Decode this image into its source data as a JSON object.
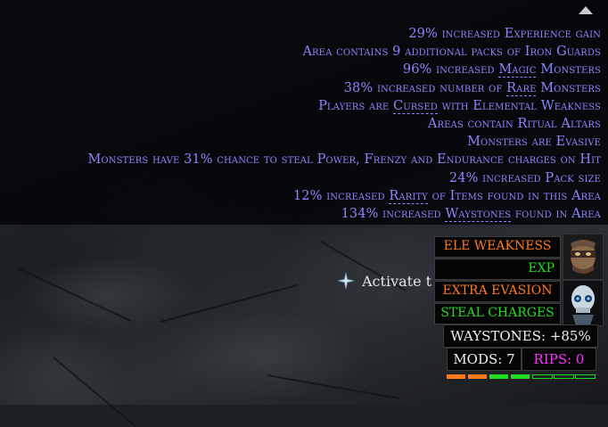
{
  "mods": [
    {
      "pre": "29% increased Experience gain",
      "kw": "",
      "post": ""
    },
    {
      "pre": "Area contains 9 additional packs of Iron Guards",
      "kw": "",
      "post": ""
    },
    {
      "pre": "96% increased ",
      "kw": "Magic",
      "post": " Monsters"
    },
    {
      "pre": "38% increased number of ",
      "kw": "Rare",
      "post": " Monsters"
    },
    {
      "pre": "Players are ",
      "kw": "Cursed",
      "post": " with Elemental Weakness"
    },
    {
      "pre": "Areas contain Ritual Altars",
      "kw": "",
      "post": ""
    },
    {
      "pre": "Monsters are Evasive",
      "kw": "",
      "post": ""
    },
    {
      "pre": "Monsters have 31% chance to steal Power, Frenzy and Endurance charges on Hit",
      "kw": "",
      "post": ""
    },
    {
      "pre": "24% increased Pack size",
      "kw": "",
      "post": ""
    },
    {
      "pre": "12% increased ",
      "kw": "Rarity",
      "post": " of Items found in this Area"
    },
    {
      "pre": "134% increased ",
      "kw": "Waystones",
      "post": " found in Area"
    }
  ],
  "prompt": {
    "text": "Activate t",
    "icon": "sparkle-icon"
  },
  "overlay": {
    "warnings": [
      {
        "label": "ELE WEAKNESS",
        "color": "#ff7a1a"
      },
      {
        "label": "EXP",
        "color": "#22dd22"
      },
      {
        "label": "EXTRA EVASION",
        "color": "#ff7a1a"
      },
      {
        "label": "STEAL CHARGES",
        "color": "#22dd22"
      }
    ],
    "waystones": "WAYSTONES: +85%",
    "mods": "MODS: 7",
    "rips": "RIPS: 0",
    "segments": [
      "#ff7a1a",
      "#ff7a1a",
      "#22dd22",
      "#22dd22",
      "#22dd22",
      "#22dd22",
      "#22dd22"
    ],
    "segments_filled": [
      true,
      true,
      true,
      true,
      false,
      false,
      false
    ],
    "colors": {
      "orange": "#ff7a1a",
      "green": "#22dd22",
      "magenta": "#ff33ff",
      "mod_text": "#8888ff"
    }
  }
}
